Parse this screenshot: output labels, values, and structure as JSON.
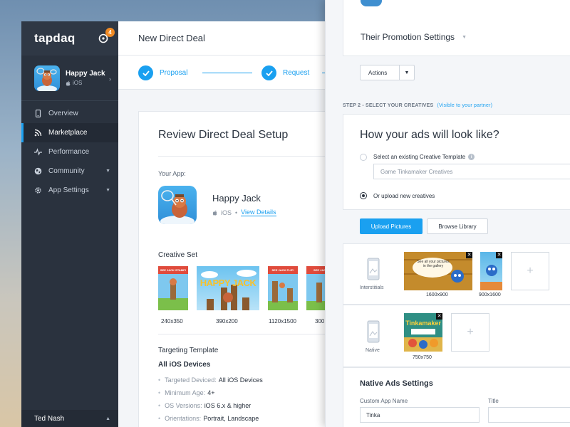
{
  "brand": {
    "logo_text": "tapdaq",
    "notification_count": "4",
    "accent": "#1aa0f0",
    "sidebar_bg": "#2a323e"
  },
  "app_switcher": {
    "name": "Happy Jack",
    "platform": "iOS"
  },
  "sidebar": {
    "items": [
      {
        "label": "Overview",
        "icon": "mobile-icon"
      },
      {
        "label": "Marketplace",
        "icon": "rss-icon",
        "active": true
      },
      {
        "label": "Performance",
        "icon": "pulse-icon"
      },
      {
        "label": "Community",
        "icon": "globe-icon"
      },
      {
        "label": "App Settings",
        "icon": "gear-icon"
      }
    ],
    "user_name": "Ted Nash"
  },
  "main": {
    "title": "New Direct Deal",
    "steps": [
      "Proposal",
      "Request"
    ],
    "card": {
      "heading": "Review Direct Deal Setup",
      "your_app_label": "Your App:",
      "app_name": "Happy Jack",
      "app_platform": "iOS",
      "view_details": "View Details",
      "creative_set_label": "Creative Set",
      "creatives": [
        {
          "size": "240x350",
          "banner": "SEE JACK STAMP!"
        },
        {
          "size": "390x200",
          "banner": "HAPPY JACK"
        },
        {
          "size": "1120x1500",
          "banner": "SEE JACK FLIP!"
        },
        {
          "size": "300",
          "banner": "SEE JACK"
        }
      ],
      "targeting_label": "Targeting Template",
      "targeting_name": "All iOS Devices",
      "targeting_rules": [
        {
          "key": "Targeted Deviced:",
          "value": "All iOS Devices"
        },
        {
          "key": "Minimum Age:",
          "value": "4+"
        },
        {
          "key": "OS Versions:",
          "value": "iOS 6.x & higher"
        },
        {
          "key": "Orientations:",
          "value": "Portrait, Landscape"
        }
      ]
    }
  },
  "panel": {
    "promotion_settings": "Their Promotion Settings",
    "actions_label": "Actions",
    "step2_label": "STEP 2 - SELECT YOUR CREATIVES",
    "step2_visibility": "(Visible to your partner)",
    "question": "How your ads will look like?",
    "option_existing": "Select an existing Creative Template",
    "template_value": "Game Tinkamaker Creatives",
    "option_upload": "Or upload new creatives",
    "upload_button": "Upload Pictures",
    "browse_button": "Browse Library",
    "interstitials_label": "Interstitials",
    "interstitial_sizes": [
      "1600x900",
      "900x1600"
    ],
    "interstitial_banner_text": "See all your pictures in the gallery",
    "native_label": "Native",
    "native_sizes": [
      "750x750"
    ],
    "native_banner_text": "Tinkamaker",
    "native_ads_settings": "Native Ads Settings",
    "custom_app_name_label": "Custom App Name",
    "custom_app_name_value": "Tinka",
    "title_label": "Title"
  }
}
